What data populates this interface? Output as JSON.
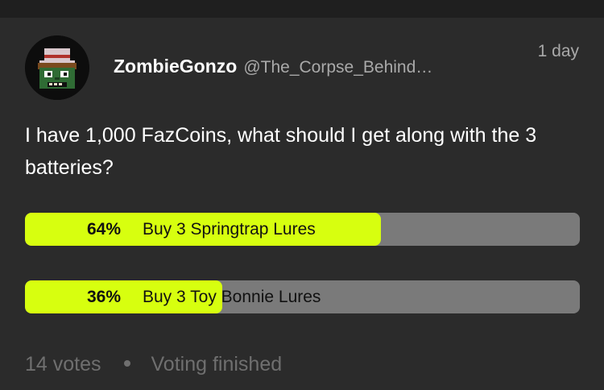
{
  "post": {
    "author": {
      "display_name": "ZombieGonzo",
      "handle": "@The_Corpse_Behind…",
      "avatar_icon": "zombie-avatar-icon"
    },
    "timestamp": "1 day",
    "question": "I have 1,000 FazCoins, what should I get along with the 3 batteries?"
  },
  "poll": {
    "options": [
      {
        "percent_label": "64%",
        "label": "Buy 3 Springtrap Lures",
        "percent": 64
      },
      {
        "percent_label": "36%",
        "label": "Buy 3 Toy Bonnie Lures",
        "percent": 36
      }
    ],
    "votes": "14 votes",
    "status": "Voting finished"
  },
  "colors": {
    "background": "#1f1f1f",
    "card": "#2b2b2b",
    "accent": "#d7ff0f",
    "bar_track": "#7a7a7a",
    "muted_text": "#a9a9a9"
  }
}
